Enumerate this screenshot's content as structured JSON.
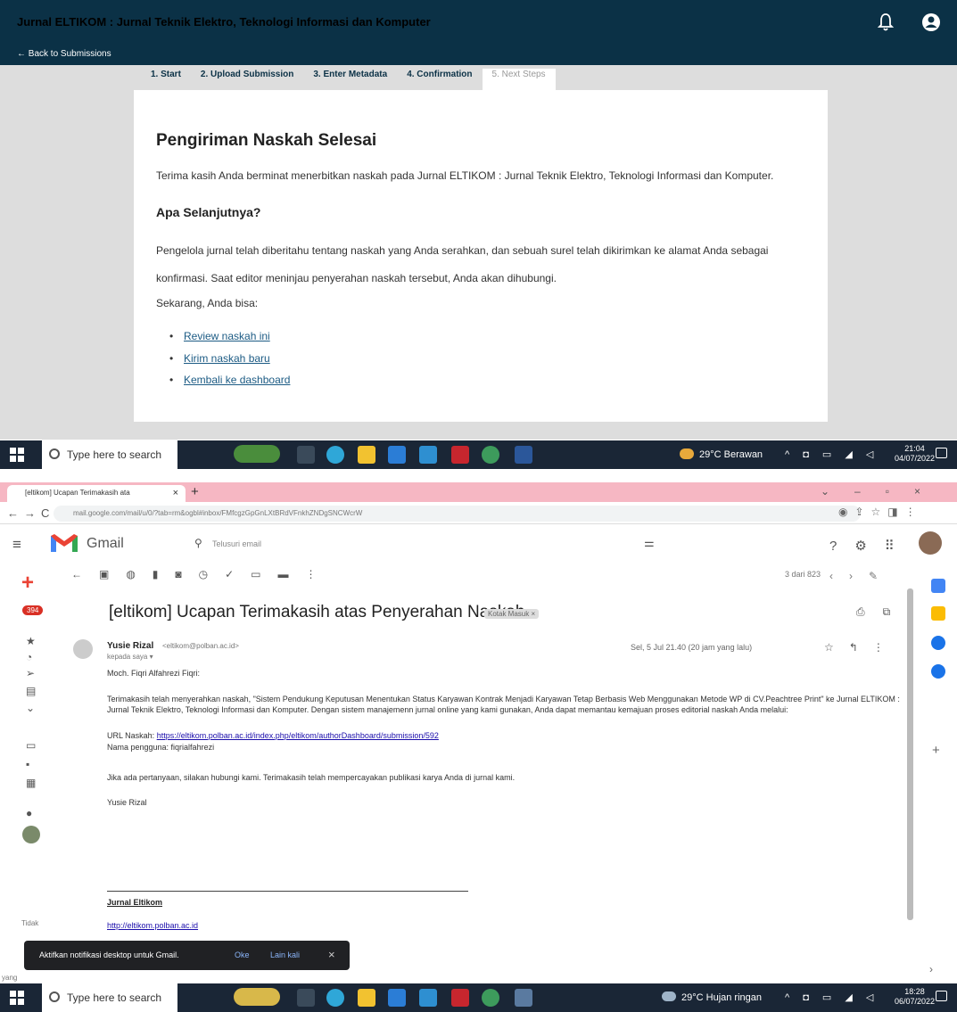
{
  "ojs": {
    "title": "Jurnal ELTIKOM : Jurnal Teknik Elektro, Teknologi Informasi dan Komputer",
    "back": "← Back to Submissions",
    "steps": [
      "1. Start",
      "2. Upload Submission",
      "3. Enter Metadata",
      "4. Confirmation",
      "5. Next Steps"
    ],
    "heading": "Pengiriman Naskah Selesai",
    "thanks": "Terima kasih Anda berminat menerbitkan naskah pada Jurnal ELTIKOM : Jurnal Teknik Elektro, Teknologi Informasi dan Komputer.",
    "next_heading": "Apa Selanjutnya?",
    "next_text": "Pengelola jurnal telah diberitahu tentang naskah yang Anda serahkan, dan sebuah surel telah dikirimkan ke alamat Anda sebagai konfirmasi. Saat editor meninjau penyerahan naskah tersebut, Anda akan dihubungi.",
    "can_do": "Sekarang, Anda bisa:",
    "links": [
      "Review naskah ini",
      "Kirim naskah baru",
      "Kembali ke dashboard"
    ]
  },
  "taskbar1": {
    "search": "Type here to search",
    "weather": "29°C  Berawan",
    "time": "21:04",
    "date": "04/07/2022"
  },
  "chrome": {
    "tab_title": "[eltikom] Ucapan Terimakasih ata",
    "url": "mail.google.com/mail/u/0/?tab=rm&ogbl#inbox/FMfcgzGpGnLXtBRdVFnkhZNDgSNCWcrW"
  },
  "gmail": {
    "brand": "Gmail",
    "search_placeholder": "Telusuri email",
    "badge": "394",
    "pager": "3 dari 823",
    "subject": "[eltikom] Ucapan Terimakasih atas Penyerahan Naskah",
    "inbox_chip": "Kotak Masuk ×",
    "sender_name": "Yusie Rizal",
    "sender_email": "<eltikom@polban.ac.id>",
    "to": "kepada saya ▾",
    "date": "Sel, 5 Jul 21.40 (20 jam yang lalu)",
    "greeting": "Moch. Fiqri Alfahrezi Fiqri:",
    "body1": "Terimakasih telah menyerahkan naskah, \"Sistem Pendukung Keputusan Menentukan Status Karyawan Kontrak Menjadi Karyawan Tetap Berbasis Web Menggunakan Metode WP di CV.Peachtree Print\" ke Jurnal ELTIKOM : Jurnal Teknik Elektro, Teknologi Informasi dan Komputer. Dengan sistem manajemenn jurnal online yang kami gunakan, Anda dapat memantau kemajuan proses editorial naskah Anda melalui:",
    "url_label": "URL Naskah: ",
    "url_link": "https://eltikom.polban.ac.id/index.php/eltikom/authorDashboard/submission/592",
    "username": "Nama pengguna: fiqrialfahrezi",
    "body2": "Jika ada pertanyaan, silakan hubungi kami. Terimakasih telah mempercayakan publikasi karya Anda di jurnal kami.",
    "signoff": "Yusie Rizal",
    "sig_name": "Jurnal Eltikom",
    "sig_url": "http://eltikom.polban.ac.id",
    "side_tidak": "Tidak",
    "side_yang": "yang",
    "snack_text": "Aktifkan notifikasi desktop untuk Gmail.",
    "snack_ok": "Oke",
    "snack_later": "Lain kali"
  },
  "taskbar2": {
    "search": "Type here to search",
    "weather": "29°C  Hujan ringan",
    "time": "18:28",
    "date": "06/07/2022"
  },
  "colors": {
    "ojs_header": "#0b3146",
    "taskbar": "#1a2636",
    "chrome_tabs": "#f6b7c3",
    "gmail_red": "#ea4335",
    "link": "#1c5b84"
  }
}
